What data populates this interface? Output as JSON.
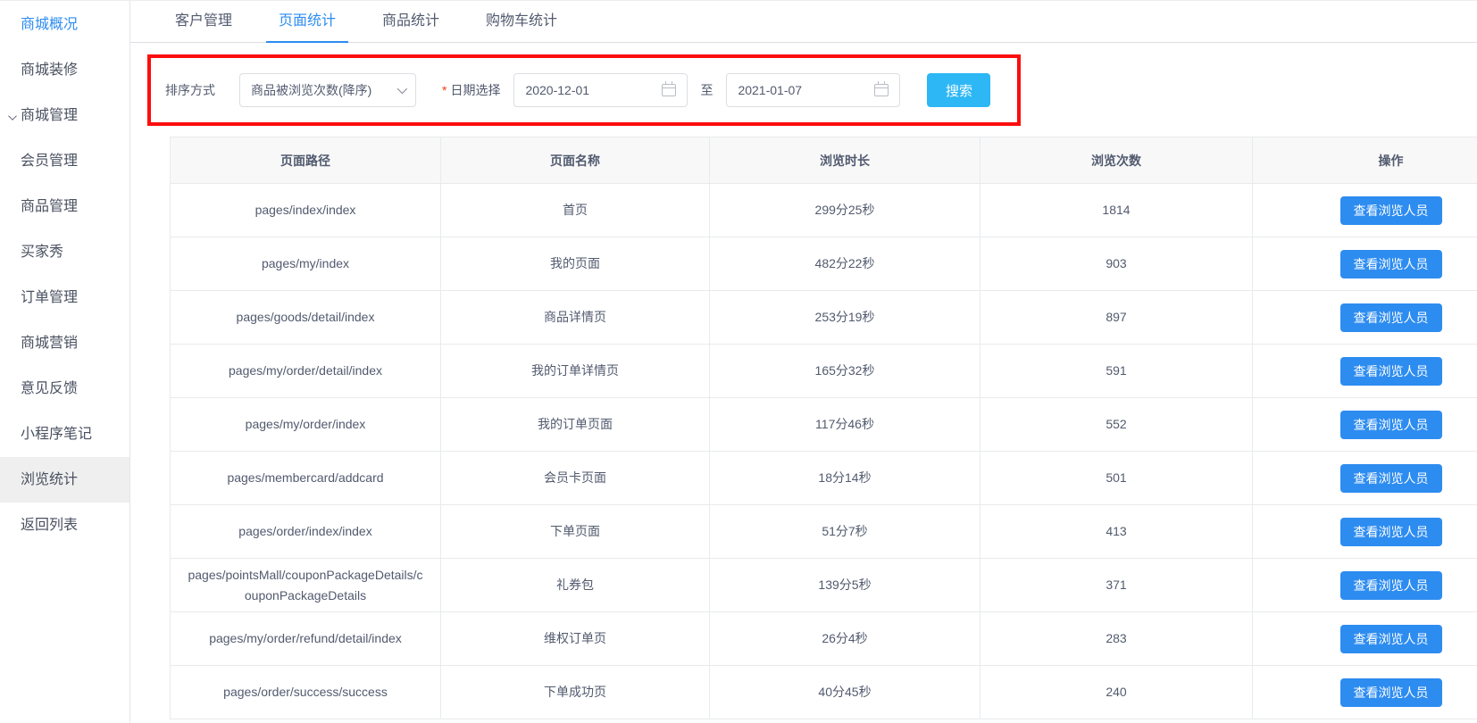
{
  "colors": {
    "primary": "#2d8cf0",
    "info_button": "#2db7f5",
    "highlight_border": "#fd0d0d",
    "selected_menu_bg": "#efefef",
    "table_header_bg": "#f8f8f9",
    "required_mark": "#ed4014"
  },
  "icons": {
    "menu_expand": "chevron-down",
    "select_arrow": "chevron-down",
    "date_picker": "calendar"
  },
  "sidebar": {
    "items": [
      {
        "label": "商城概况",
        "accent": true
      },
      {
        "label": "商城装修"
      },
      {
        "label": "商城管理",
        "chevron": true
      },
      {
        "label": "会员管理"
      },
      {
        "label": "商品管理"
      },
      {
        "label": "买家秀"
      },
      {
        "label": "订单管理"
      },
      {
        "label": "商城营销"
      },
      {
        "label": "意见反馈"
      },
      {
        "label": "小程序笔记"
      },
      {
        "label": "浏览统计",
        "selected": true
      },
      {
        "label": "返回列表"
      }
    ]
  },
  "tabs": [
    {
      "label": "客户管理"
    },
    {
      "label": "页面统计",
      "active": true
    },
    {
      "label": "商品统计"
    },
    {
      "label": "购物车统计"
    }
  ],
  "filter": {
    "sort_label": "排序方式",
    "sort_value": "商品被浏览次数(降序)",
    "required_mark": "*",
    "date_label": "日期选择",
    "date_from": "2020-12-01",
    "to_label": "至",
    "date_to": "2021-01-07",
    "search_label": "搜索"
  },
  "table": {
    "headers": [
      "页面路径",
      "页面名称",
      "浏览时长",
      "浏览次数",
      "操作"
    ],
    "action_label": "查看浏览人员",
    "rows": [
      {
        "path": "pages/index/index",
        "name": "首页",
        "duration": "299分25秒",
        "views": "1814"
      },
      {
        "path": "pages/my/index",
        "name": "我的页面",
        "duration": "482分22秒",
        "views": "903"
      },
      {
        "path": "pages/goods/detail/index",
        "name": "商品详情页",
        "duration": "253分19秒",
        "views": "897"
      },
      {
        "path": "pages/my/order/detail/index",
        "name": "我的订单详情页",
        "duration": "165分32秒",
        "views": "591"
      },
      {
        "path": "pages/my/order/index",
        "name": "我的订单页面",
        "duration": "117分46秒",
        "views": "552"
      },
      {
        "path": "pages/membercard/addcard",
        "name": "会员卡页面",
        "duration": "18分14秒",
        "views": "501"
      },
      {
        "path": "pages/order/index/index",
        "name": "下单页面",
        "duration": "51分7秒",
        "views": "413"
      },
      {
        "path": "pages/pointsMall/couponPackageDetails/couponPackageDetails",
        "name": "礼券包",
        "duration": "139分5秒",
        "views": "371"
      },
      {
        "path": "pages/my/order/refund/detail/index",
        "name": "维权订单页",
        "duration": "26分4秒",
        "views": "283"
      },
      {
        "path": "pages/order/success/success",
        "name": "下单成功页",
        "duration": "40分45秒",
        "views": "240"
      }
    ]
  }
}
